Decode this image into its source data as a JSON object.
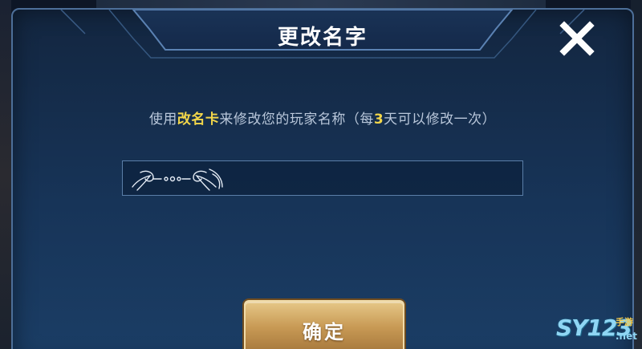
{
  "dialog": {
    "title": "更改名字",
    "instruction": {
      "before": "使用",
      "item": "改名卡",
      "middle": "来修改您的玩家名称（每",
      "number": "3",
      "after": "天可以修改一次）"
    },
    "input": {
      "value": "",
      "placeholder": ""
    },
    "confirm_label": "确定",
    "close_icon": "close-icon"
  },
  "watermark": {
    "brand": "SY123",
    "sub": "手游",
    "domain": ".net"
  },
  "colors": {
    "highlight": "#f2d64a",
    "panel": "#173458",
    "border": "#4d6f99",
    "button_gold": "#c89a55"
  }
}
